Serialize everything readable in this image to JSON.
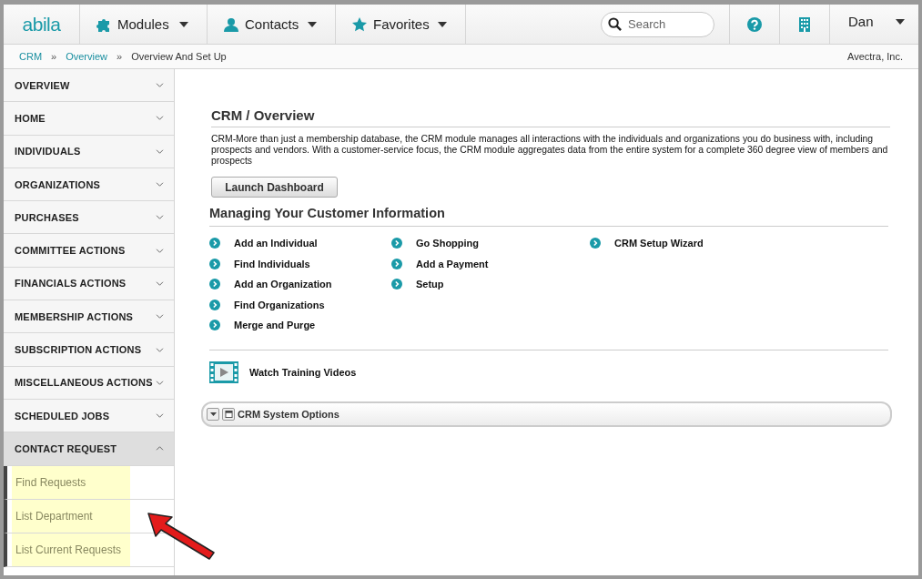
{
  "topbar": {
    "logo": "abila",
    "menus": [
      {
        "label": "Modules",
        "kind": "puzzle"
      },
      {
        "label": "Contacts",
        "kind": "person"
      },
      {
        "label": "Favorites",
        "kind": "star"
      }
    ],
    "search": {
      "placeholder": "Search"
    },
    "user": "Dan"
  },
  "breadcrumb": {
    "items": [
      {
        "label": "CRM",
        "link": true
      },
      {
        "label": "Overview",
        "link": true
      },
      {
        "label": "Overview And Set Up",
        "link": false
      }
    ],
    "separator": "»",
    "org": "Avectra, Inc."
  },
  "sidebar": {
    "items": [
      {
        "label": "OVERVIEW",
        "expanded": false
      },
      {
        "label": "HOME",
        "expanded": false
      },
      {
        "label": "INDIVIDUALS",
        "expanded": false
      },
      {
        "label": "ORGANIZATIONS",
        "expanded": false
      },
      {
        "label": "PURCHASES",
        "expanded": false
      },
      {
        "label": "COMMITTEE ACTIONS",
        "expanded": false
      },
      {
        "label": "FINANCIALS ACTIONS",
        "expanded": false
      },
      {
        "label": "MEMBERSHIP ACTIONS",
        "expanded": false
      },
      {
        "label": "SUBSCRIPTION ACTIONS",
        "expanded": false
      },
      {
        "label": "MISCELLANEOUS ACTIONS",
        "expanded": false
      },
      {
        "label": "SCHEDULED JOBS",
        "expanded": false
      },
      {
        "label": "CONTACT REQUEST",
        "expanded": true,
        "children": [
          {
            "label": "Find Requests",
            "highlighted": true
          },
          {
            "label": "List Department",
            "highlighted": true
          },
          {
            "label": "List Current Requests",
            "highlighted": true
          }
        ]
      }
    ]
  },
  "main": {
    "title": "CRM / Overview",
    "description": "CRM-More than just a membership database, the CRM module manages all interactions with the individuals and organizations you do business with, including prospects and vendors. With a customer-service focus, the CRM module aggregates data from the entire system for a complete 360 degree view of members and prospects",
    "button": "Launch Dashboard",
    "section_title": "Managing Your Customer Information",
    "link_columns": [
      [
        "Add an Individual",
        "Find Individuals",
        "Add an Organization",
        "Find Organizations",
        "Merge and Purge"
      ],
      [
        "Go Shopping",
        "Add a Payment",
        "Setup"
      ],
      [
        "CRM Setup Wizard"
      ]
    ],
    "training": "Watch Training Videos",
    "options_panel": {
      "title": "CRM System Options",
      "expanded": false
    }
  }
}
